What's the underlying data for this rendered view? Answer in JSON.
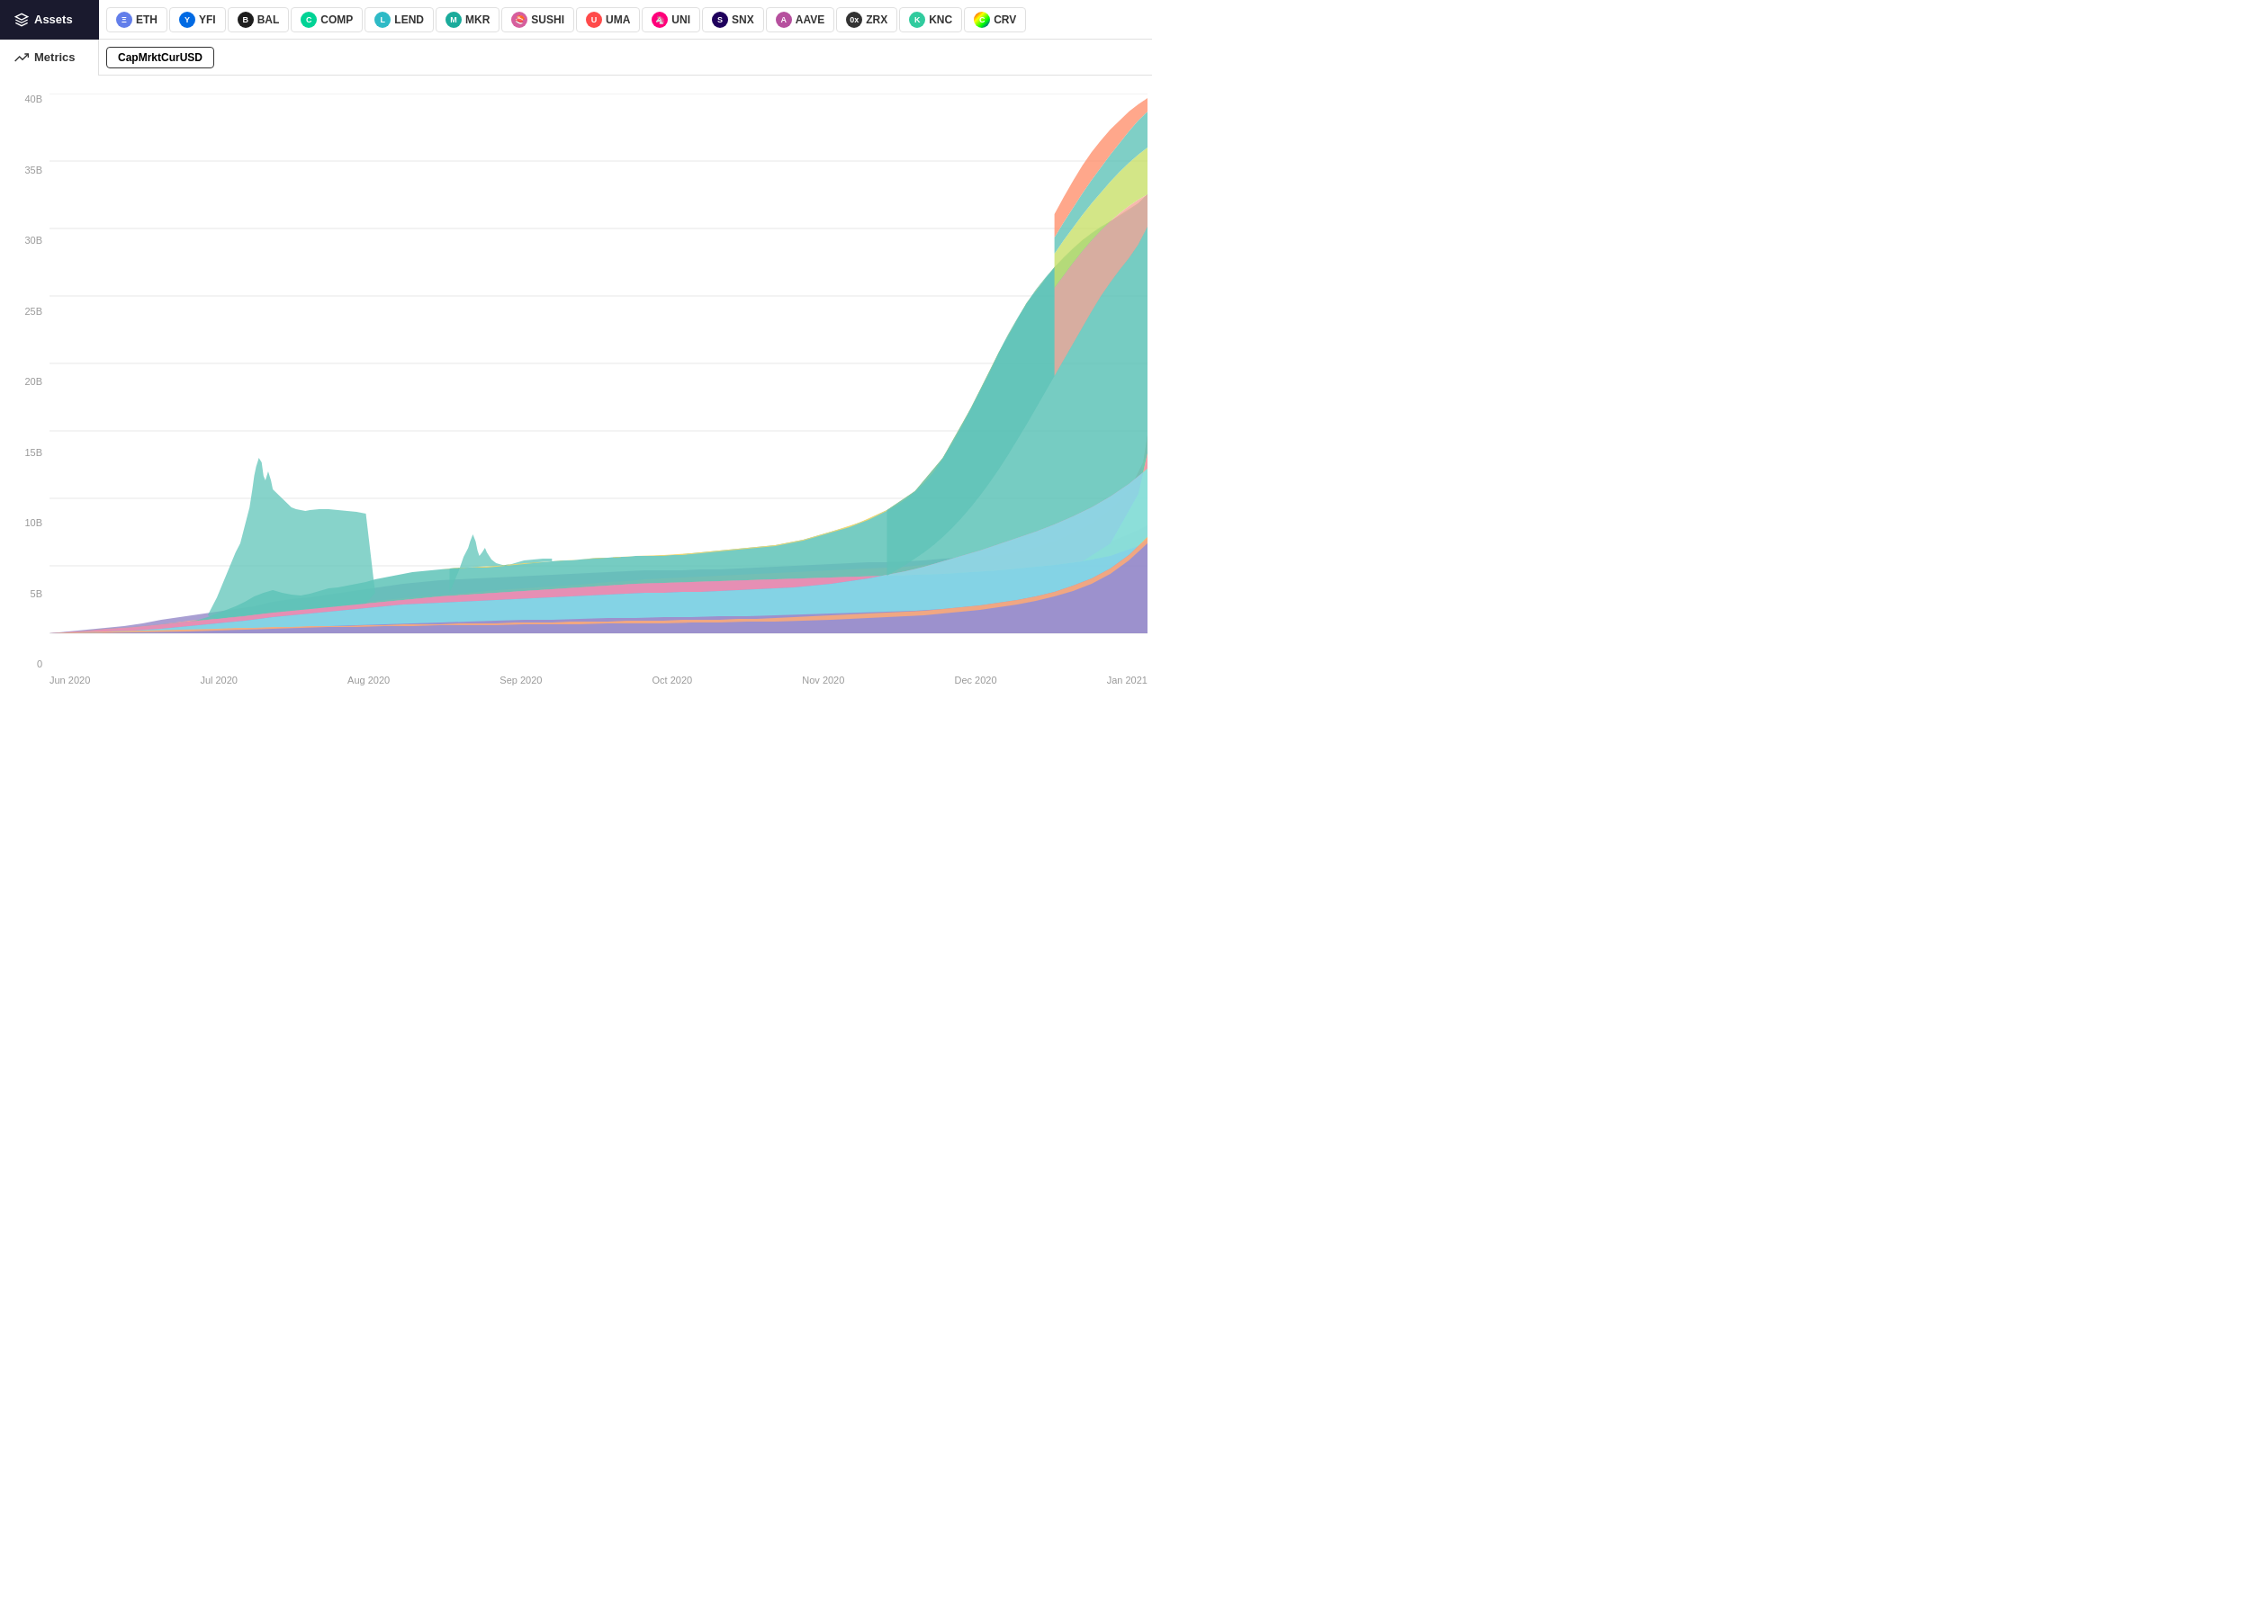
{
  "header": {
    "assets_label": "Assets",
    "metrics_label": "Metrics",
    "metric_chip": "CapMrktCurUSD"
  },
  "tokens": [
    {
      "symbol": "ETH",
      "color": "#627eea",
      "bg": "#627eea"
    },
    {
      "symbol": "YFI",
      "color": "#006ae3",
      "bg": "#006ae3"
    },
    {
      "symbol": "BAL",
      "color": "#1d1d1d",
      "bg": "#1d1d1d"
    },
    {
      "symbol": "COMP",
      "color": "#00d395",
      "bg": "#00d395"
    },
    {
      "symbol": "LEND",
      "color": "#2ebac6",
      "bg": "#2ebac6"
    },
    {
      "symbol": "MKR",
      "color": "#1aab9b",
      "bg": "#1aab9b"
    },
    {
      "symbol": "SUSHI",
      "color": "#d65e9d",
      "bg": "#d65e9d"
    },
    {
      "symbol": "UMA",
      "color": "#ff4a4a",
      "bg": "#ff4a4a"
    },
    {
      "symbol": "UNI",
      "color": "#ff007a",
      "bg": "#ff007a"
    },
    {
      "symbol": "SNX",
      "color": "#1f005c",
      "bg": "#1f005c"
    },
    {
      "symbol": "AAVE",
      "color": "#b6509e",
      "bg": "#b6509e"
    },
    {
      "symbol": "ZRX",
      "color": "#231815",
      "bg": "#231815"
    },
    {
      "symbol": "KNC",
      "color": "#31cb9e",
      "bg": "#31cb9e"
    },
    {
      "symbol": "CRV",
      "color": "#d9d9d9",
      "bg": "#888"
    }
  ],
  "y_labels": [
    "0",
    "5B",
    "10B",
    "15B",
    "20B",
    "25B",
    "30B",
    "35B",
    "40B"
  ],
  "x_labels": [
    "Jun 2020",
    "Jul 2020",
    "Aug 2020",
    "Sep 2020",
    "Oct 2020",
    "Nov 2020",
    "Dec 2020",
    "Jan 2021"
  ],
  "chart": {
    "colors": {
      "purple_blue": "#9b8ec4",
      "light_green": "#c5e17a",
      "salmon": "#f4a89a",
      "teal": "#5fc4b8",
      "yellow": "#f5d76e",
      "pink": "#f48fb1",
      "cyan": "#80deea",
      "orange": "#ffab76",
      "light_blue": "#90caf9",
      "coral": "#ff8a65",
      "mint": "#a5d6a7"
    }
  }
}
